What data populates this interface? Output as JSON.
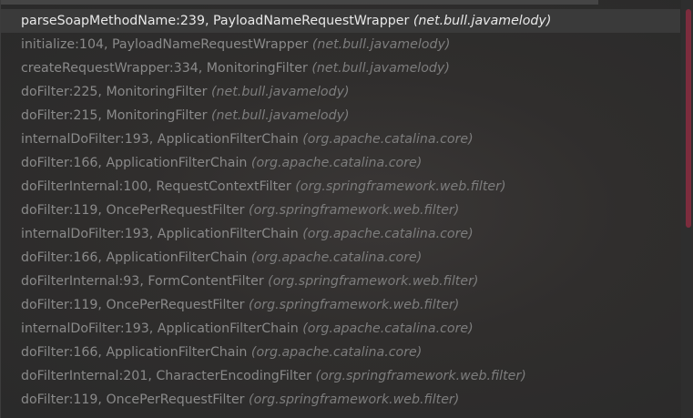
{
  "frames": [
    {
      "method": "parseSoapMethodName:239, PayloadNameRequestWrapper",
      "package": "(net.bull.javamelody)",
      "selected": true
    },
    {
      "method": "initialize:104, PayloadNameRequestWrapper",
      "package": "(net.bull.javamelody)",
      "selected": false
    },
    {
      "method": "createRequestWrapper:334, MonitoringFilter",
      "package": "(net.bull.javamelody)",
      "selected": false
    },
    {
      "method": "doFilter:225, MonitoringFilter",
      "package": "(net.bull.javamelody)",
      "selected": false
    },
    {
      "method": "doFilter:215, MonitoringFilter",
      "package": "(net.bull.javamelody)",
      "selected": false
    },
    {
      "method": "internalDoFilter:193, ApplicationFilterChain",
      "package": "(org.apache.catalina.core)",
      "selected": false
    },
    {
      "method": "doFilter:166, ApplicationFilterChain",
      "package": "(org.apache.catalina.core)",
      "selected": false
    },
    {
      "method": "doFilterInternal:100, RequestContextFilter",
      "package": "(org.springframework.web.filter)",
      "selected": false
    },
    {
      "method": "doFilter:119, OncePerRequestFilter",
      "package": "(org.springframework.web.filter)",
      "selected": false
    },
    {
      "method": "internalDoFilter:193, ApplicationFilterChain",
      "package": "(org.apache.catalina.core)",
      "selected": false
    },
    {
      "method": "doFilter:166, ApplicationFilterChain",
      "package": "(org.apache.catalina.core)",
      "selected": false
    },
    {
      "method": "doFilterInternal:93, FormContentFilter",
      "package": "(org.springframework.web.filter)",
      "selected": false
    },
    {
      "method": "doFilter:119, OncePerRequestFilter",
      "package": "(org.springframework.web.filter)",
      "selected": false
    },
    {
      "method": "internalDoFilter:193, ApplicationFilterChain",
      "package": "(org.apache.catalina.core)",
      "selected": false
    },
    {
      "method": "doFilter:166, ApplicationFilterChain",
      "package": "(org.apache.catalina.core)",
      "selected": false
    },
    {
      "method": "doFilterInternal:201, CharacterEncodingFilter",
      "package": "(org.springframework.web.filter)",
      "selected": false
    },
    {
      "method": "doFilter:119, OncePerRequestFilter",
      "package": "(org.springframework.web.filter)",
      "selected": false
    }
  ],
  "colors": {
    "selected_text": "#e8e8e8",
    "frame_text": "#8a8a8a",
    "scroll_thumb": "#8a2c3f"
  }
}
